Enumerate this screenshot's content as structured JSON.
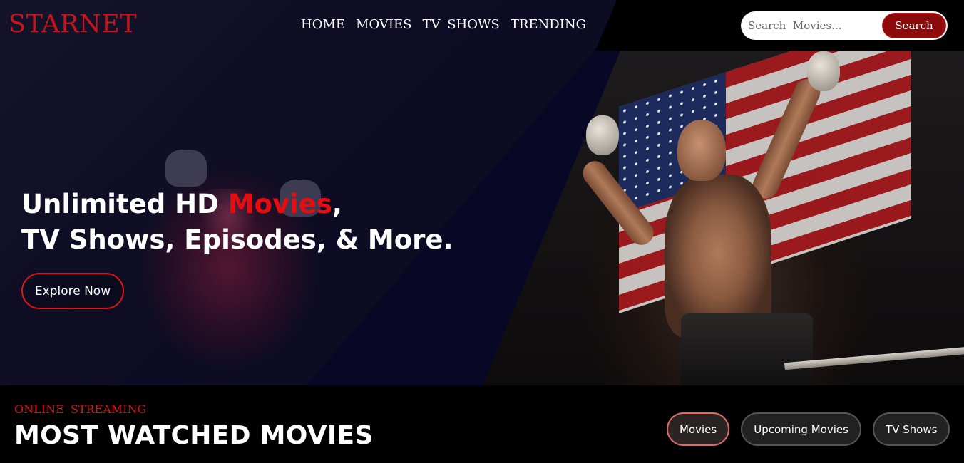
{
  "brand": {
    "logo": "STARNET"
  },
  "nav": {
    "items": [
      {
        "label": "HOME"
      },
      {
        "label": "MOVIES"
      },
      {
        "label": "TV  SHOWS"
      },
      {
        "label": "TRENDING"
      }
    ]
  },
  "search": {
    "placeholder": "Search  Movies...",
    "value": "",
    "button_label": "Search"
  },
  "hero": {
    "headline_part1": "Unlimited HD ",
    "headline_accent": "Movies",
    "headline_part2": ",",
    "headline_line2": "TV Shows, Episodes, & More.",
    "cta_label": "Explore Now"
  },
  "section": {
    "eyebrow": "ONLINE  STREAMING",
    "title": "MOST WATCHED MOVIES",
    "tabs": [
      {
        "label": "Movies",
        "active": true
      },
      {
        "label": "Upcoming Movies",
        "active": false
      },
      {
        "label": "TV Shows",
        "active": false
      }
    ]
  },
  "colors": {
    "brand_red": "#c5161e",
    "accent_red": "#e60c10",
    "button_dark_red": "#8d0b0b"
  }
}
